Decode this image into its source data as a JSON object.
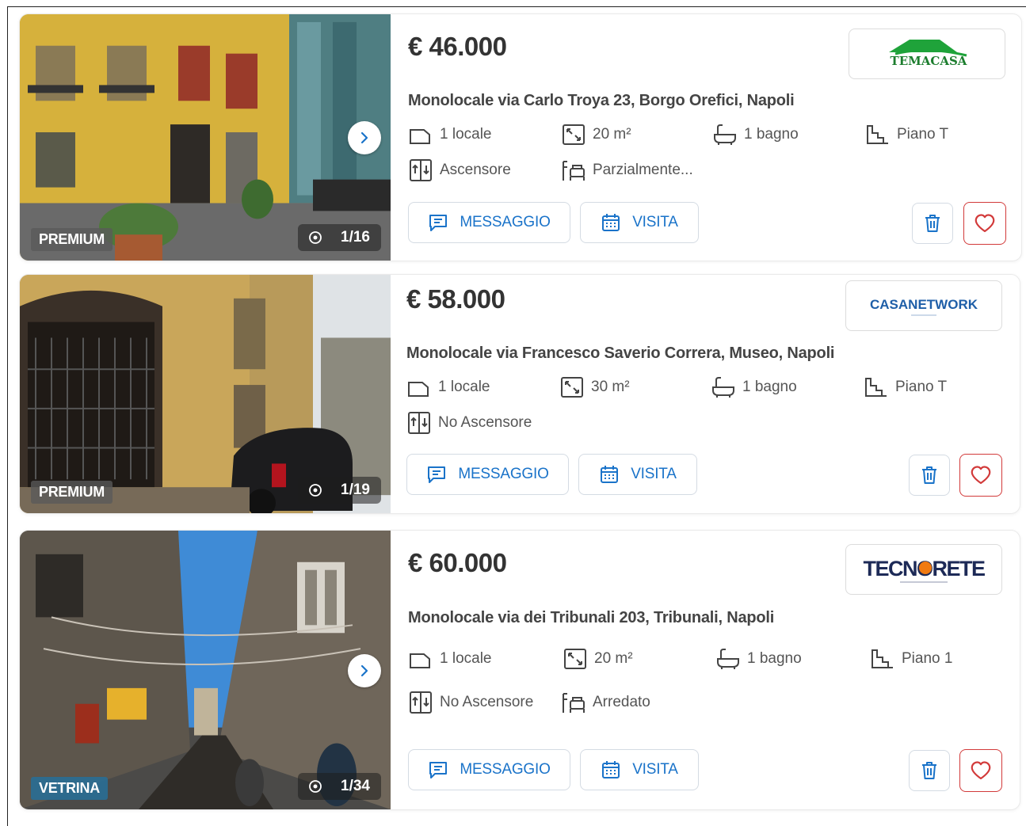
{
  "actions": {
    "message_label": "MESSAGGIO",
    "visit_label": "VISITA"
  },
  "listings": [
    {
      "price": "€ 46.000",
      "title": "Monolocale via Carlo Troya 23, Borgo Orefici, Napoli",
      "badge": "PREMIUM",
      "photo_counter": "1/16",
      "agency_logo_text": "TEMACASA",
      "features": {
        "rooms": "1 locale",
        "area": "20 m²",
        "bathrooms": "1 bagno",
        "floor": "Piano T",
        "elevator": "Ascensore",
        "furnished": "Parzialmente..."
      }
    },
    {
      "price": "€ 58.000",
      "title": "Monolocale via Francesco Saverio Correra, Museo, Napoli",
      "badge": "PREMIUM",
      "photo_counter": "1/19",
      "agency_logo_text": "CASANETWORK",
      "features": {
        "rooms": "1 locale",
        "area": "30 m²",
        "bathrooms": "1 bagno",
        "floor": "Piano T",
        "elevator": "No Ascensore"
      }
    },
    {
      "price": "€ 60.000",
      "title": "Monolocale via dei Tribunali 203, Tribunali, Napoli",
      "badge": "VETRINA",
      "photo_counter": "1/34",
      "agency_logo_text": "TECNORETE",
      "features": {
        "rooms": "1 locale",
        "area": "20 m²",
        "bathrooms": "1 bagno",
        "floor": "Piano 1",
        "elevator": "No Ascensore",
        "furnished": "Arredato"
      }
    }
  ],
  "colors": {
    "accent_blue": "#1a73c9",
    "favorite_red": "#d23a3a",
    "premium_badge": "#5a5a5a",
    "vetrina_badge": "#286e96"
  }
}
